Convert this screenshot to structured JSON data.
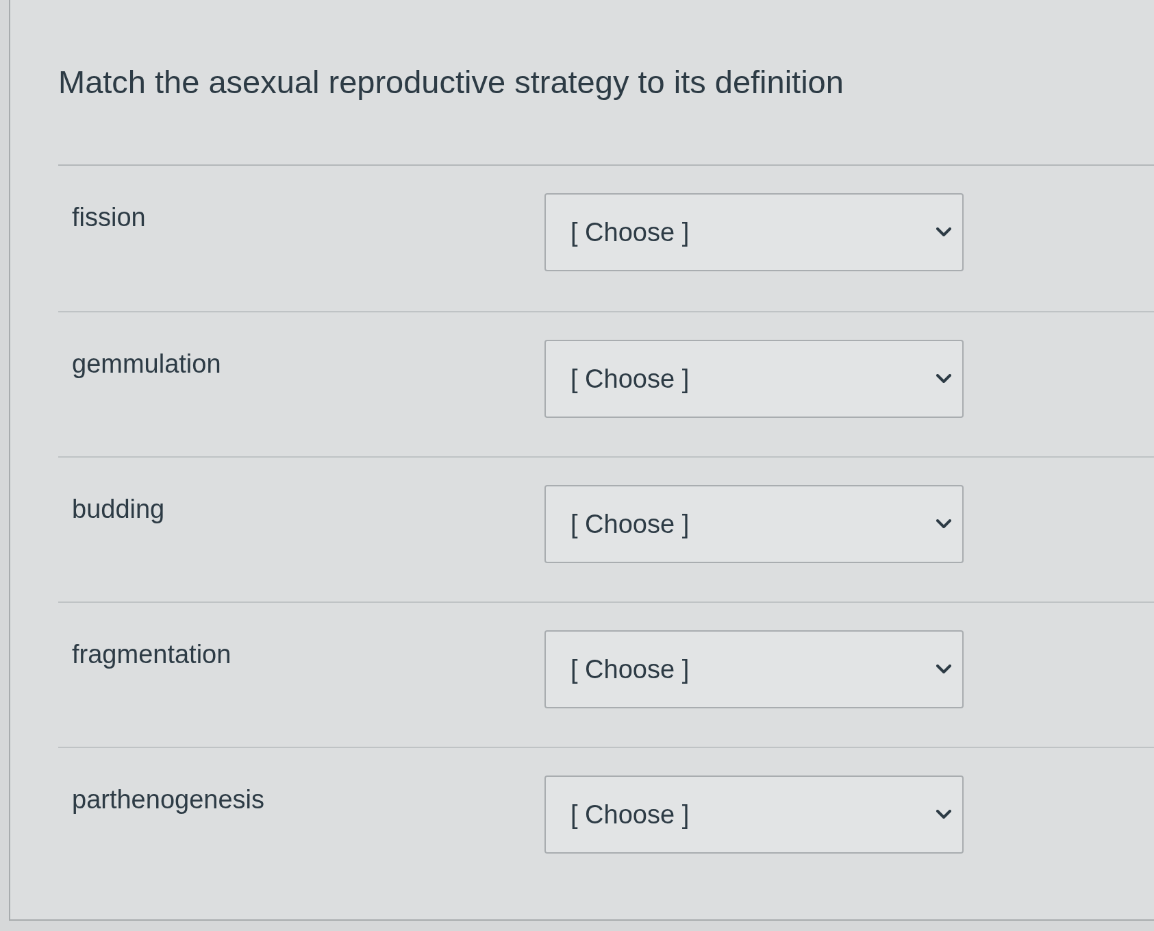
{
  "question": {
    "title": "Match the asexual reproductive strategy to its definition"
  },
  "matches": [
    {
      "term": "fission",
      "choice": "[ Choose ]"
    },
    {
      "term": "gemmulation",
      "choice": "[ Choose ]"
    },
    {
      "term": "budding",
      "choice": "[ Choose ]"
    },
    {
      "term": "fragmentation",
      "choice": "[ Choose ]"
    },
    {
      "term": "parthenogenesis",
      "choice": "[ Choose ]"
    }
  ]
}
